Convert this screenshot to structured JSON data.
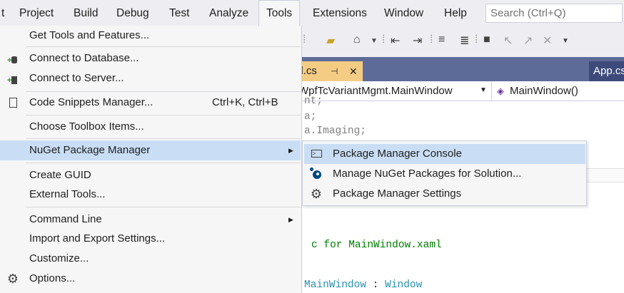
{
  "menubar": {
    "items": [
      "t",
      "Project",
      "Build",
      "Debug",
      "Test",
      "Analyze",
      "Tools",
      "Extensions",
      "Window",
      "Help"
    ],
    "active": "Tools",
    "search_placeholder": "Search (Ctrl+Q)"
  },
  "tabs": {
    "active_label": "al.cs",
    "pin_glyph": "⊣",
    "close_glyph": "✕",
    "right_label": "App.cs"
  },
  "navbar": {
    "class_label": "WpfTcVariantMgmt.MainWindow",
    "member_label": "MainWindow()"
  },
  "code_lines": {
    "l1": "nt;",
    "l2": "a;",
    "l3": "a.Imaging;",
    "l4_comment": "c for MainWindow.xaml",
    "l5_type": "MainWindow",
    "l5_sep": " : ",
    "l5_base": "Window"
  },
  "tools_menu": {
    "items": [
      {
        "label": "Get Tools and Features...",
        "icon": "none"
      },
      {
        "label": "Connect to Database...",
        "icon": "database-add-icon"
      },
      {
        "label": "Connect to Server...",
        "icon": "server-add-icon"
      },
      {
        "label": "Code Snippets Manager...",
        "shortcut": "Ctrl+K, Ctrl+B",
        "icon": "snippet-icon"
      },
      {
        "label": "Choose Toolbox Items...",
        "icon": "none"
      },
      {
        "label": "NuGet Package Manager",
        "submenu": true,
        "highlighted": true
      },
      {
        "label": "Create GUID"
      },
      {
        "label": "External Tools..."
      },
      {
        "label": "Command Line",
        "submenu": true
      },
      {
        "label": "Import and Export Settings..."
      },
      {
        "label": "Customize..."
      },
      {
        "label": "Options...",
        "icon": "gear-icon"
      }
    ]
  },
  "nuget_submenu": {
    "items": [
      {
        "label": "Package Manager Console",
        "icon": "console-icon",
        "highlighted": true
      },
      {
        "label": "Manage NuGet Packages for Solution...",
        "icon": "nuget-icon"
      },
      {
        "label": "Package Manager Settings",
        "icon": "gear-icon"
      }
    ]
  },
  "colors": {
    "menu_highlight": "#c9def5",
    "tab_active": "#f5cc84",
    "tabstrip": "#5d6b99",
    "keyword": "#0000ff",
    "comment": "#008000",
    "type": "#2b91af"
  }
}
